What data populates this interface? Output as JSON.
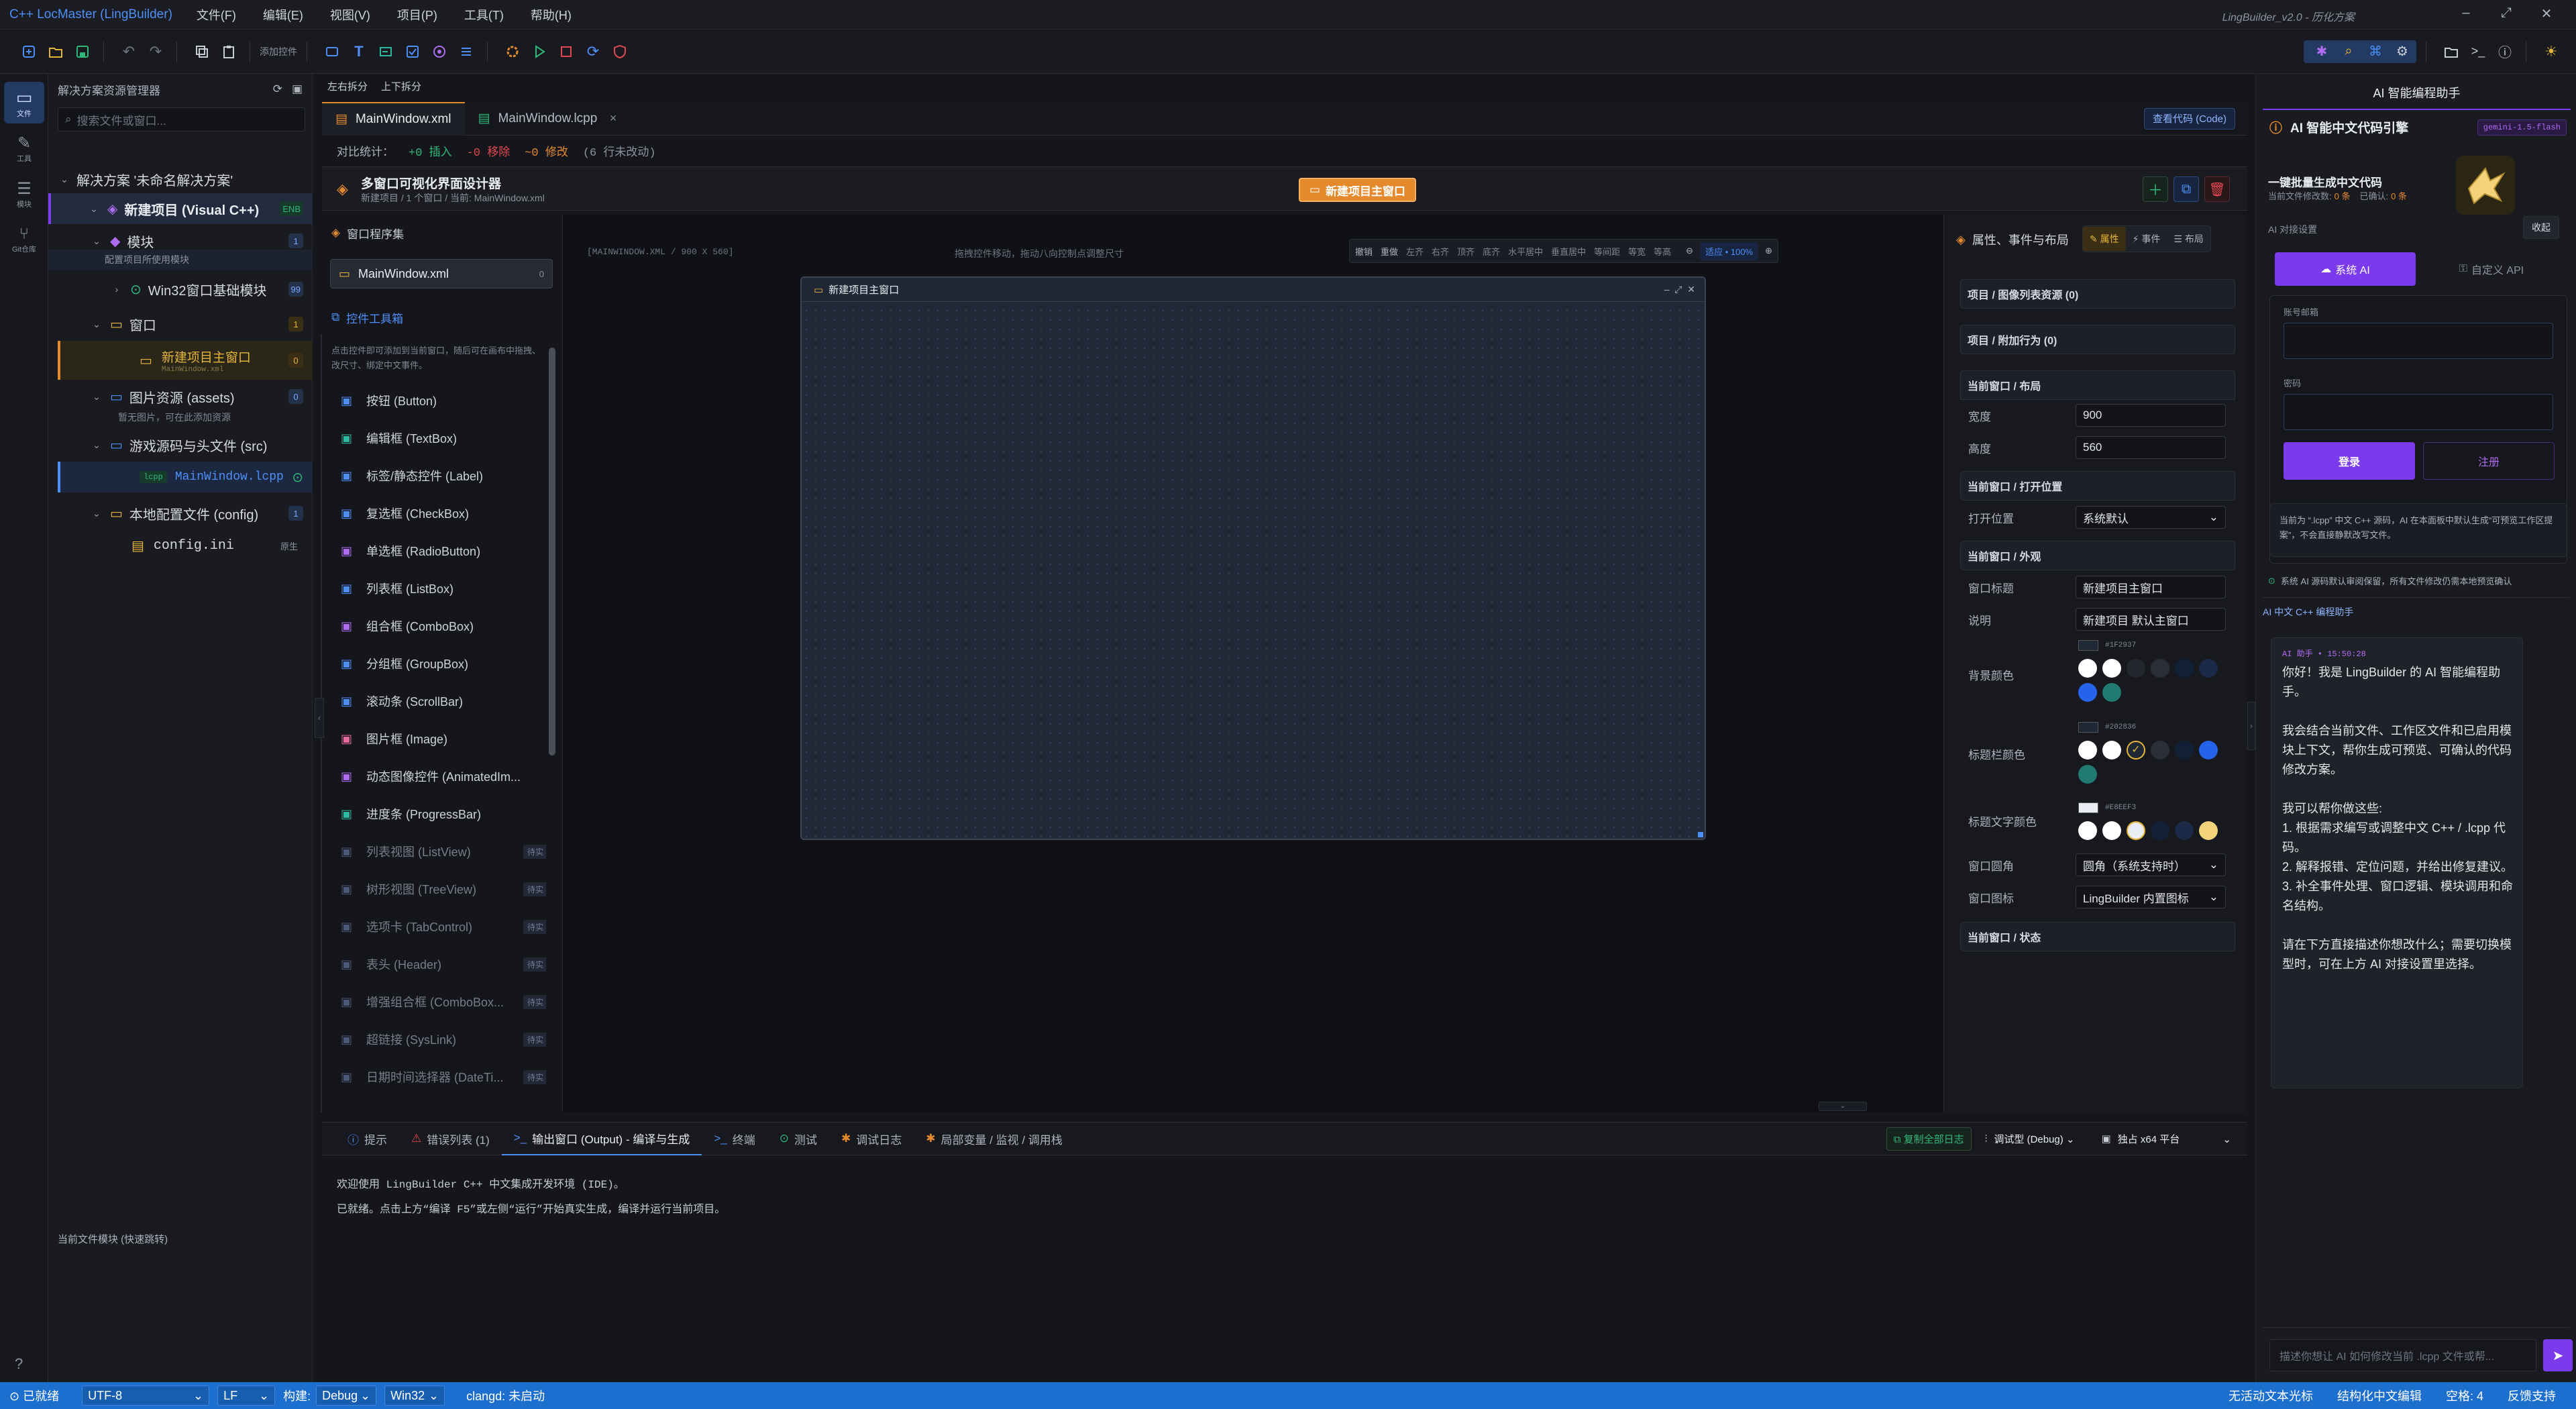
{
  "app": {
    "brand": "C++ LocMaster (LingBuilder)",
    "menu": [
      "文件(F)",
      "编辑(E)",
      "视图(V)",
      "项目(P)",
      "工具(T)",
      "帮助(H)"
    ],
    "right_title": "LingBuilder_v2.0 - 历化方案"
  },
  "toolbar": {
    "add_control": "添加控件"
  },
  "activity": [
    "文件",
    "工具",
    "模块",
    "Git仓库"
  ],
  "explorer": {
    "title": "解决方案资源管理器",
    "search_placeholder": "搜索文件或窗口...",
    "solution": "解决方案 '未命名解决方案'",
    "project": "新建项目 (Visual C++)",
    "project_badge": "ENB",
    "modules": "模块",
    "modules_badge": "1",
    "modules_hint": "配置项目所使用模块",
    "win32": "Win32窗口基础模块",
    "win32_badge": "99",
    "windows": "窗口",
    "windows_badge": "1",
    "main_window": "新建项目主窗口",
    "main_window_file": "MainWindow.xml",
    "main_window_badge": "0",
    "images": "图片资源 (assets)",
    "images_badge": "0",
    "images_hint": "暂无图片，可在此添加资源",
    "src": "游戏源码与头文件 (src)",
    "lcpp_tag": "lcpp",
    "lcpp_file": "MainWindow.lcpp",
    "config": "本地配置文件 (config)",
    "config_badge": "1",
    "config_ini": "config.ini",
    "config_ini_tag": "原生",
    "bottom_label": "当前文件模块 (快速跳转)"
  },
  "split": {
    "left": "左右拆分",
    "up": "上下拆分"
  },
  "tabs": {
    "xml": "MainWindow.xml",
    "lcpp": "MainWindow.lcpp",
    "view_code": "查看代码 (Code)"
  },
  "diff": {
    "label": "对比统计：",
    "ins": "+0 插入",
    "del": "-0 移除",
    "mod": "~0 修改",
    "lines": "(6 行未改动)"
  },
  "designer": {
    "title": "多窗口可视化界面设计器",
    "sub": "新建项目 / 1 个窗口 / 当前: MainWindow.xml",
    "new_window_btn": "新建项目主窗口"
  },
  "windows_panel": {
    "title": "窗口程序集",
    "item": "MainWindow.xml",
    "item_count": "0"
  },
  "toolbox": {
    "title": "控件工具箱",
    "hint": "点击控件即可添加到当前窗口，随后可在画布中拖拽、改尺寸、绑定中文事件。",
    "items": [
      {
        "label": "按钮 (Button)",
        "icon": "button-icon",
        "color": "#4d8ff7",
        "dis": false
      },
      {
        "label": "编辑框 (TextBox)",
        "icon": "textbox-icon",
        "color": "#2fb8a0",
        "dis": false
      },
      {
        "label": "标签/静态控件 (Label)",
        "icon": "label-icon",
        "color": "#4d8ff7",
        "dis": false
      },
      {
        "label": "复选框 (CheckBox)",
        "icon": "checkbox-icon",
        "color": "#4d8ff7",
        "dis": false
      },
      {
        "label": "单选框 (RadioButton)",
        "icon": "radio-icon",
        "color": "#b06cf0",
        "dis": false
      },
      {
        "label": "列表框 (ListBox)",
        "icon": "listbox-icon",
        "color": "#4d8ff7",
        "dis": false
      },
      {
        "label": "组合框 (ComboBox)",
        "icon": "combobox-icon",
        "color": "#b06cf0",
        "dis": false
      },
      {
        "label": "分组框 (GroupBox)",
        "icon": "groupbox-icon",
        "color": "#4d8ff7",
        "dis": false
      },
      {
        "label": "滚动条 (ScrollBar)",
        "icon": "scrollbar-icon",
        "color": "#4d8ff7",
        "dis": false
      },
      {
        "label": "图片框 (Image)",
        "icon": "image-icon",
        "color": "#e86aa0",
        "dis": false
      },
      {
        "label": "动态图像控件 (AnimatedIm...",
        "icon": "animated-icon",
        "color": "#b06cf0",
        "dis": false
      },
      {
        "label": "进度条 (ProgressBar)",
        "icon": "progress-icon",
        "color": "#2fb8a0",
        "dis": false
      },
      {
        "label": "列表视图 (ListView)",
        "icon": "listview-icon",
        "color": "#4d8ff7",
        "dis": true
      },
      {
        "label": "树形视图 (TreeView)",
        "icon": "treeview-icon",
        "color": "#4d8ff7",
        "dis": true
      },
      {
        "label": "选项卡 (TabControl)",
        "icon": "tab-icon",
        "color": "#4d8ff7",
        "dis": true
      },
      {
        "label": "表头 (Header)",
        "icon": "header-icon",
        "color": "#4d8ff7",
        "dis": true
      },
      {
        "label": "增强组合框 (ComboBox...",
        "icon": "combo-ex-icon",
        "color": "#4d8ff7",
        "dis": true
      },
      {
        "label": "超链接 (SysLink)",
        "icon": "link-icon",
        "color": "#4d8ff7",
        "dis": true
      },
      {
        "label": "日期时间选择器 (DateTi...",
        "icon": "datetime-icon",
        "color": "#4d8ff7",
        "dis": true
      }
    ],
    "pending": "待实"
  },
  "canvas": {
    "info": "[MAINWINDOW.XML / 900 X 560]",
    "hint": "拖拽控件移动，拖动八向控制点调整尺寸",
    "undo": "撤销",
    "redo": "重做",
    "align_tools": [
      "左齐",
      "右齐",
      "顶齐",
      "底齐",
      "水平居中",
      "垂直居中",
      "等间距",
      "等宽",
      "等高"
    ],
    "zoom": "适应 • 100%",
    "window_title": "新建项目主窗口"
  },
  "props": {
    "title": "属性、事件与布局",
    "tabs": [
      "属性",
      "事件",
      "布局"
    ],
    "sec_image_list": "项目 / 图像列表资源 (0)",
    "sec_behavior": "项目 / 附加行为 (0)",
    "sec_layout": "当前窗口 / 布局",
    "width_label": "宽度",
    "width": "900",
    "height_label": "高度",
    "height": "560",
    "sec_open": "当前窗口 / 打开位置",
    "open_label": "打开位置",
    "open_value": "系统默认",
    "sec_look": "当前窗口 / 外观",
    "win_title_label": "窗口标题",
    "win_title": "新建项目主窗口",
    "desc_label": "说明",
    "desc": "新建项目 默认主窗口",
    "bg_label": "背景颜色",
    "bg_hex": "#1F2937",
    "tb_label": "标题栏颜色",
    "tb_hex": "#202836",
    "tt_label": "标题文字颜色",
    "tt_hex": "#E8EEF3",
    "corner_label": "窗口圆角",
    "corner_value": "圆角（系统支持时）",
    "icon_label": "窗口图标",
    "icon_value": "LingBuilder 内置图标",
    "sec_state": "当前窗口 / 状态"
  },
  "bottom": {
    "tabs": [
      "提示",
      "错误列表 (1)",
      "输出窗口 (Output) - 编译与生成",
      "终端",
      "测试",
      "调试日志",
      "局部变量 / 监视 / 调用栈"
    ],
    "copy_log": "复制全部日志",
    "config": "调试型 (Debug)",
    "platform": "独占 x64 平台",
    "out_line1": "欢迎使用 LingBuilder C++ 中文集成开发环境 (IDE)。",
    "out_line2": "已就绪。点击上方“编译 F5”或左侧“运行”开始真实生成，编译并运行当前项目。"
  },
  "ai": {
    "header": "AI 智能编程助手",
    "engine": "AI 智能中文代码引擎",
    "model": "gemini-1.5-flash",
    "batch_title": "一键批量生成中文代码",
    "batch_sub_a": "当前文件修改数:",
    "batch_sub_a_val": "0 条",
    "batch_sub_b": "已确认:",
    "batch_sub_b_val": "0 条",
    "conn_label": "AI 对接设置",
    "collapse": "收起",
    "tab_system": "系统 AI",
    "tab_custom": "自定义 API",
    "account_label": "账号邮箱",
    "password_label": "密码",
    "login": "登录",
    "register": "注册",
    "note": "当前为 “.lcpp” 中文 C++ 源码，AI 在本面板中默认生成“可预览工作区提案”，不会直接静默改写文件。",
    "status": "系统 AI 源码默认审阅保留，所有文件修改仍需本地预览确认",
    "section": "AI 中文 C++ 编程助手",
    "msg_meta": "AI 助手 • 15:50:28",
    "msg": [
      "你好！我是 LingBuilder 的 AI 智能编程助手。",
      "我会结合当前文件、工作区文件和已启用模块上下文，帮你生成可预览、可确认的代码修改方案。",
      "我可以帮你做这些:",
      "1. 根据需求编写或调整中文 C++ / .lcpp 代码。",
      "2. 解释报错、定位问题，并给出修复建议。",
      "3. 补全事件处理、窗口逻辑、模块调用和命名结构。",
      "请在下方直接描述你想改什么；需要切换模型时，可在上方 AI 对接设置里选择。"
    ],
    "input_placeholder": "描述你想让 AI 如何修改当前 .lcpp 文件或帮..."
  },
  "status": {
    "ready": "已就绪",
    "encoding": "UTF-8",
    "eol": "LF",
    "build_label": "构建:",
    "build": "Debug",
    "platform": "Win32",
    "clangd": "clangd: 未启动",
    "right": [
      "无活动文本光标",
      "结构化中文编辑",
      "空格: 4",
      "反馈支持"
    ]
  },
  "colors": {
    "accent": "#4d8ff7",
    "orange": "#e58a2c",
    "purple": "#7c3aed",
    "status": "#1c6ecf"
  }
}
